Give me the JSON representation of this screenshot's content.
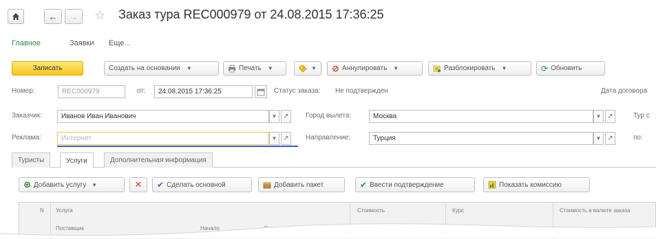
{
  "window": {
    "title": "Заказ тура REC000979 от 24.08.2015 17:36:25"
  },
  "sections": {
    "main": "Главное",
    "requests": "Заявки",
    "more": "Еще..."
  },
  "toolbar": {
    "save": "Записать",
    "create_based": "Создать на основании",
    "print": "Печать",
    "cancel": "Аннулировать",
    "unlock": "Разблокировать",
    "refresh": "Обновить"
  },
  "form": {
    "number_label": "Номер:",
    "number_value": "REC000979",
    "from_label": "от:",
    "date_value": "24.08.2015 17:36:25",
    "status_label": "Статус заказа:",
    "status_value": "Не подтвержден",
    "contract_date_label": "Дата договора",
    "customer_label": "Заказчик:",
    "customer_value": "Иванов Иван Иванович",
    "city_label": "Город вылета:",
    "city_value": "Москва",
    "type_label": "Тур с",
    "ad_label": "Реклама:",
    "ad_placeholder": "Интернет",
    "direction_label": "Направление:",
    "direction_value": "Турция",
    "by_label": "по:"
  },
  "tabs": [
    {
      "label": "Туристы"
    },
    {
      "label": "Услуги"
    },
    {
      "label": "Дополнительная информация"
    }
  ],
  "services_toolbar": {
    "add_service": "Добавить услугу",
    "make_main": "Сделать основной",
    "add_package": "Добавить пакет",
    "enter_confirmation": "Ввести подтверждение",
    "show_commission": "Показать комиссию"
  },
  "table": {
    "col_n": "N",
    "col_service": "Услуга",
    "col_supplier": "Поставщик",
    "col_start": "Начало",
    "col_end": "Окончание",
    "col_cost": "Стоимость",
    "col_rate": "Курс",
    "col_cost_currency": "Стоимость в валюте заказа"
  },
  "colors": {
    "accent_green": "#2e8b3e",
    "save_yellow": "#f5c718",
    "focus_blue": "#3a57c8",
    "cancel_red": "#d23a2a"
  }
}
